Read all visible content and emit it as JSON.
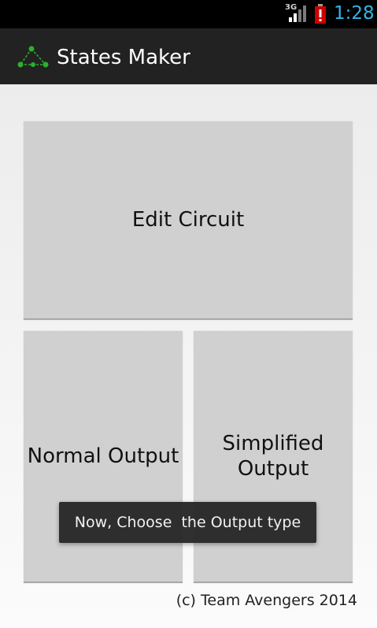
{
  "status_bar": {
    "network_label": "3G",
    "time": "1:28",
    "clock_color": "#33b5e5",
    "battery_color": "#cc0000",
    "icons": [
      "signal-icon",
      "battery-alert-icon"
    ]
  },
  "action_bar": {
    "title": "States Maker",
    "icon": "app-logo-icon",
    "icon_color": "#2db02d"
  },
  "buttons": {
    "edit_circuit": "Edit Circuit",
    "normal_output": "Normal Output",
    "simplified_output": "Simplified\nOutput"
  },
  "toast": {
    "message": "Now, Choose  the Output type"
  },
  "footer": {
    "text": "(c) Team Avengers 2014"
  }
}
